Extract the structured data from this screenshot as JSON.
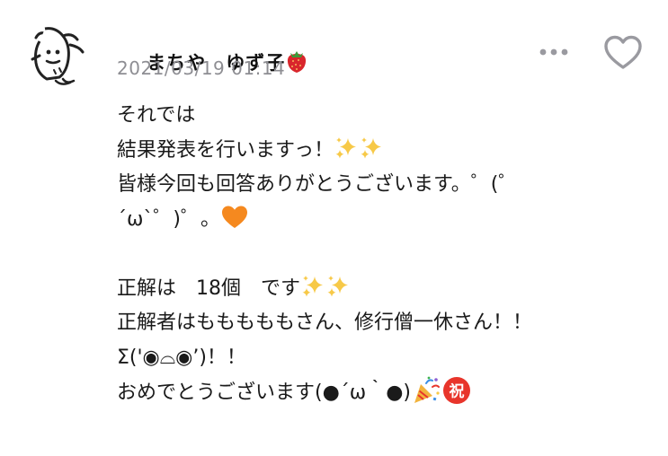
{
  "post": {
    "author_name": "まちや　ゆず子",
    "author_emoji": "strawberry-icon",
    "timestamp": "2021/03/19 01:14",
    "more_icon": "more-dots-icon",
    "like_icon": "heart-outline-icon",
    "lines": {
      "l1": "それでは",
      "l2": "結果発表を行いますっ！",
      "l3": "皆様今回も回答ありがとうございます。゜(゜",
      "l4": "´ω`゜)゜。",
      "l6": "正解は　18個　です",
      "l7": "正解者はもももももさん、修行僧一休さん！！",
      "l8": "Σ('◉⌓◉’)！！",
      "l9": "おめでとうございます(●´ω｀●)"
    }
  },
  "colors": {
    "timestamp": "#8e8e93",
    "icon_gray": "#9a9aa0",
    "sparkle": "#f7c948",
    "orange_heart": "#f5891f",
    "celebrate_red": "#e8352b"
  }
}
